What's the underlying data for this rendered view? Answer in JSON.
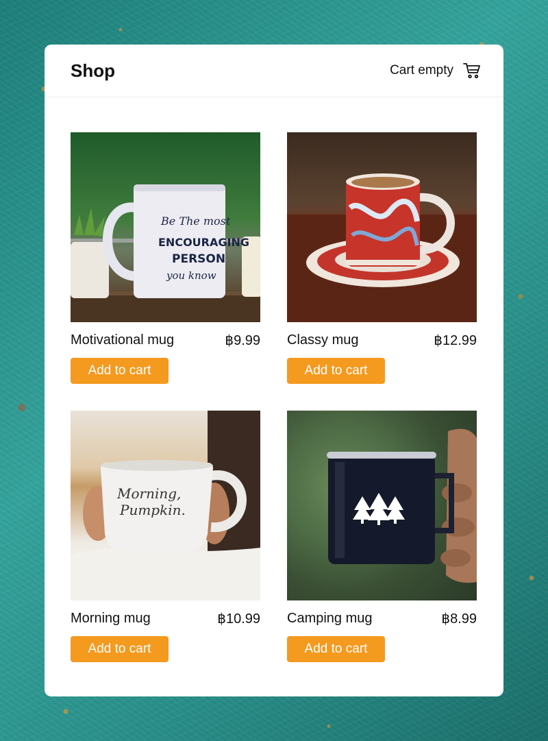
{
  "app": {
    "title": "Shop"
  },
  "cart": {
    "label": "Cart empty",
    "icon": "cart-icon"
  },
  "colors": {
    "accent": "#f49a1f",
    "background": "#2f9a93"
  },
  "products": [
    {
      "name": "Motivational mug",
      "price": "฿9.99",
      "button": "Add to cart",
      "mug_text": [
        "Be The most",
        "ENCOURAGING",
        "PERSON",
        "you know"
      ]
    },
    {
      "name": "Classy mug",
      "price": "฿12.99",
      "button": "Add to cart"
    },
    {
      "name": "Morning mug",
      "price": "฿10.99",
      "button": "Add to cart",
      "mug_text": [
        "Morning,",
        "Pumpkin."
      ]
    },
    {
      "name": "Camping mug",
      "price": "฿8.99",
      "button": "Add to cart"
    }
  ]
}
